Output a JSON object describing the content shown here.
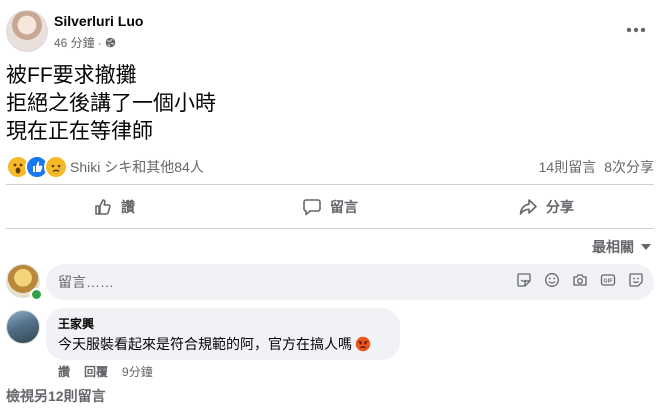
{
  "post": {
    "author": "Silverluri Luo",
    "time": "46 分鐘",
    "privacy_icon": "globe-icon",
    "more_icon": "more-horizontal-icon",
    "body_lines": [
      "被FF要求撤攤",
      "拒絕之後講了一個小時",
      "現在正在等律師"
    ]
  },
  "reactions": {
    "icons": [
      "wow-reaction-icon",
      "like-reaction-icon",
      "sad-reaction-icon"
    ],
    "names": "Shiki シキ和其他84人",
    "comments_count": "14則留言",
    "shares_count": "8次分享"
  },
  "actions": {
    "like": "讚",
    "comment": "留言",
    "share": "分享"
  },
  "sort": {
    "label": "最相關"
  },
  "composer": {
    "placeholder": "留言……",
    "tools": [
      "sticker-icon",
      "emoji-icon",
      "camera-icon",
      "gif-icon",
      "avatar-sticker-icon"
    ]
  },
  "comment": {
    "name": "王家興",
    "text": "今天服裝看起來是符合規範的阿，官方在搞人嗎",
    "emoji": "angry-face-icon",
    "like": "讚",
    "reply": "回覆",
    "time": "9分鐘"
  },
  "view_more": "檢視另12則留言",
  "colors": {
    "text_primary": "#050505",
    "text_secondary": "#65676b",
    "bubble_bg": "#f0f2f5",
    "divider": "#ced0d4",
    "like_blue": "#1877f2",
    "reaction_yellow": "#f7b928",
    "online_green": "#31a24c"
  }
}
